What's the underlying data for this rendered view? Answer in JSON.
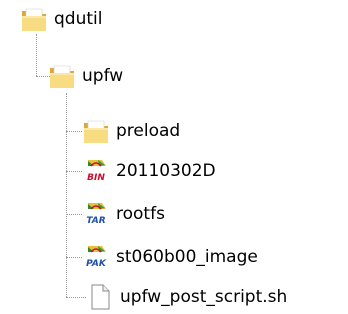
{
  "tree": {
    "root": {
      "label": "qdutil",
      "icon": "folder-icon"
    },
    "child": {
      "label": "upfw",
      "icon": "folder-icon"
    },
    "items": [
      {
        "label": "preload",
        "icon": "folder-icon"
      },
      {
        "label": "20110302D",
        "icon": "bin-archive-icon",
        "badge": "BIN"
      },
      {
        "label": "rootfs",
        "icon": "tar-archive-icon",
        "badge": "TAR"
      },
      {
        "label": "st060b00_image",
        "icon": "pak-archive-icon",
        "badge": "PAK"
      },
      {
        "label": "upfw_post_script.sh",
        "icon": "blank-file-icon"
      }
    ]
  },
  "colors": {
    "folder_light": "#f8dc82",
    "folder_dark": "#d9a93a",
    "connector": "#9a9a9a",
    "badge_red": "#c8102e",
    "badge_green": "#2f8a2f"
  }
}
